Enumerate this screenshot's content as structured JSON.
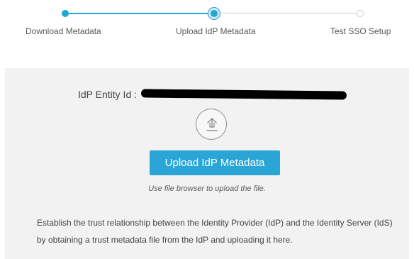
{
  "stepper": {
    "steps": [
      {
        "label": "Download Metadata",
        "status": "complete"
      },
      {
        "label": "Upload IdP Metadata",
        "status": "current"
      },
      {
        "label": "Test SSO Setup",
        "status": "pending"
      }
    ],
    "accent_color": "#22a6d5"
  },
  "panel": {
    "entity_label": "IdP Entity Id :",
    "entity_value_redacted": true,
    "upload_icon": "upload-arrow-icon",
    "upload_button_label": "Upload IdP Metadata",
    "hint": "Use file browser to upload the file.",
    "description": "Establish the trust relationship between the Identity Provider (IdP) and the Identity Server (IdS) by obtaining a trust metadata file from the IdP and uploading it here."
  }
}
